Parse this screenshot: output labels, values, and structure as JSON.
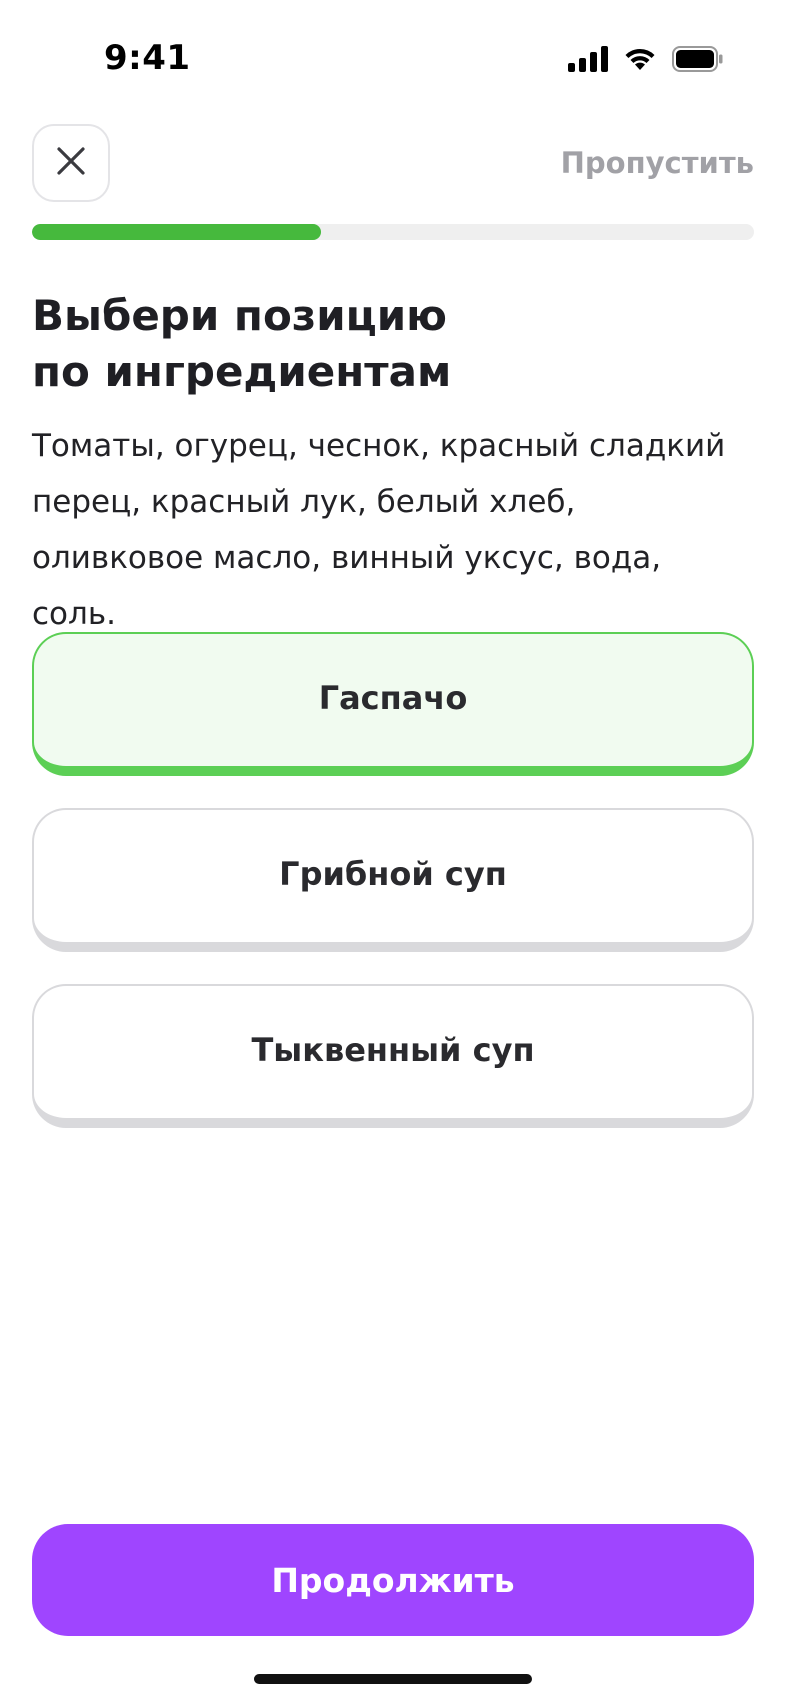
{
  "status_bar": {
    "time": "9:41",
    "icons": [
      "cellular-signal-icon",
      "wifi-icon",
      "battery-icon"
    ]
  },
  "header": {
    "close_icon": "close-icon",
    "skip_label": "Пропустить"
  },
  "progress": {
    "value": 0.4,
    "color": "#46b93d"
  },
  "question": {
    "title": "Выбери позицию\nпо ингредиентам",
    "text": "Томаты, огурец, чеснок, красный сладкий перец, красный лук, белый хлеб, оливковое масло, винный уксус, вода, соль."
  },
  "options": [
    {
      "label": "Гаспачо",
      "selected": true
    },
    {
      "label": "Грибной суп",
      "selected": false
    },
    {
      "label": "Тыквенный суп",
      "selected": false
    }
  ],
  "continue_button": {
    "label": "Продолжить",
    "color": "#9f45ff"
  }
}
